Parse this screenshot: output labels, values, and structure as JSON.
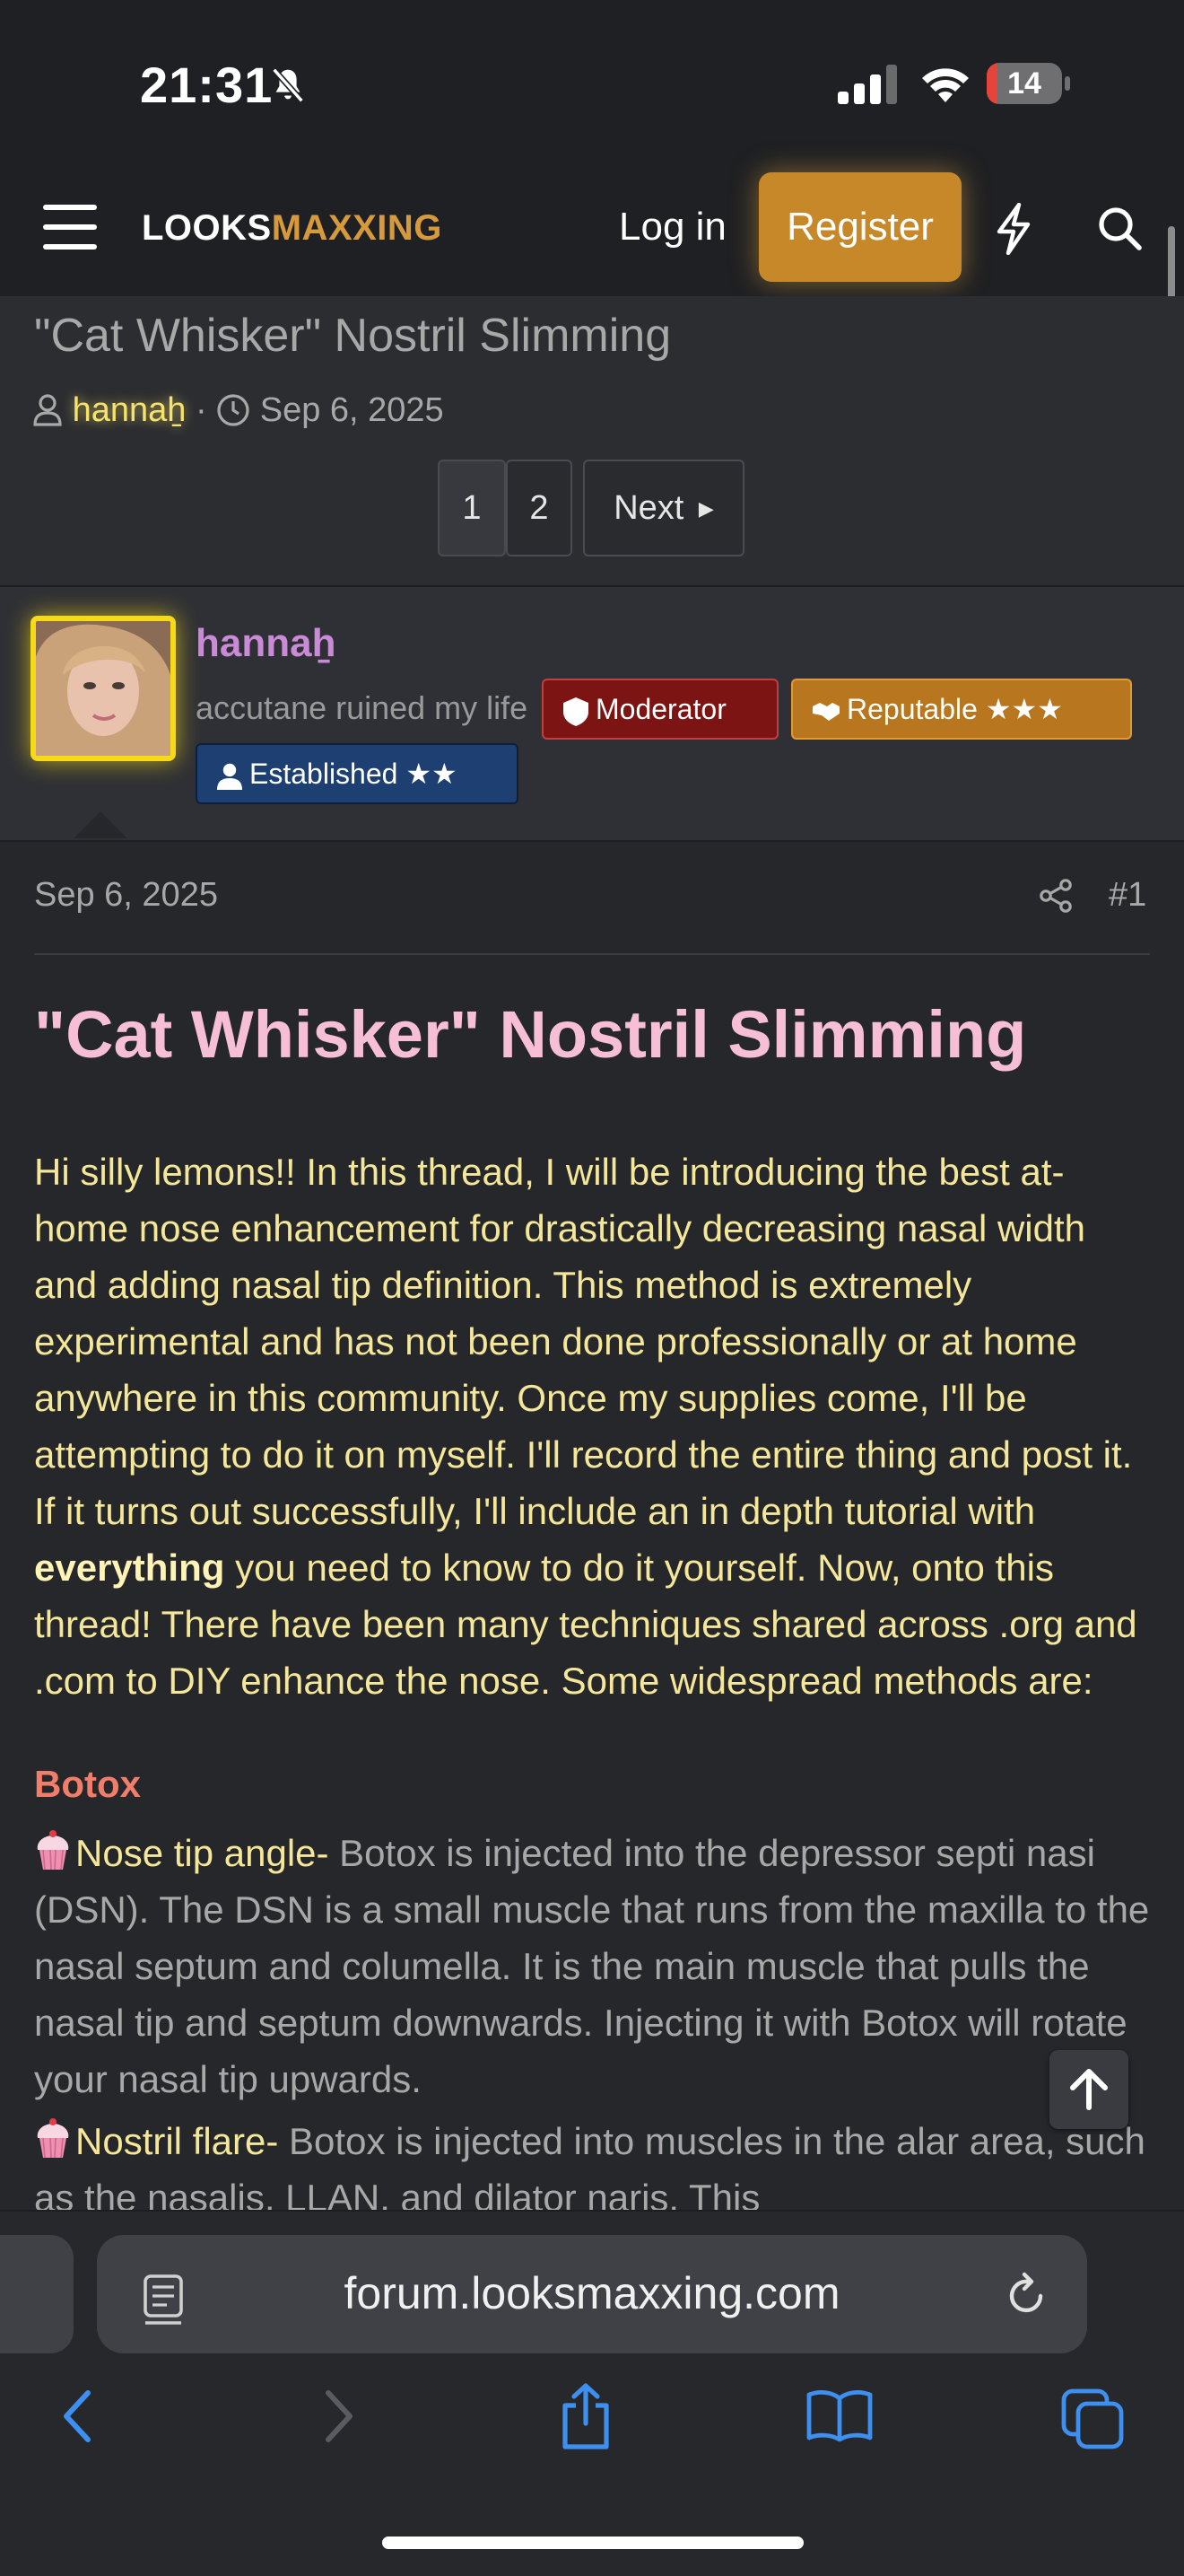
{
  "status_bar": {
    "time": "21:31",
    "battery_percent": 14
  },
  "header": {
    "logo_a": "LOOKS",
    "logo_b": "MAXXING",
    "login_label": "Log in",
    "register_label": "Register"
  },
  "thread": {
    "title": "\"Cat Whisker\" Nostril Slimming",
    "author": "hannaẖ",
    "separator": "·",
    "date": "Sep 6, 2025",
    "pages": [
      "1",
      "2"
    ],
    "current_page": "1",
    "next_label": "Next"
  },
  "user": {
    "name": "hannaẖ",
    "title": "accutane ruined my life",
    "badges": {
      "moderator": "Moderator",
      "reputable": "Reputable ★★★",
      "established": "Established ★★"
    }
  },
  "post": {
    "date": "Sep 6, 2025",
    "number": "#1",
    "title": "\"Cat Whisker\" Nostril Slimming",
    "body_1": "Hi silly lemons!! In this thread, I will be introducing the best at-home nose enhancement for drastically decreasing nasal width and adding nasal tip definition. This method is extremely experimental and has not been done professionally or at home anywhere in this community. Once my supplies come, I'll be attempting to do it on myself. I'll record the entire thing and post it. If it turns out successfully, I'll include an in depth tutorial with ",
    "body_bold": "everything",
    "body_2": " you need to know to do it yourself. Now, onto this thread! There have been many techniques shared across .org and .com to DIY enhance the nose. Some widespread methods are:",
    "section_botox": "Botox",
    "bullet_1_lead": "Nose tip angle-",
    "bullet_1_text": " Botox is injected into the depressor septi nasi (DSN). The DSN is a small muscle that runs from the maxilla to the nasal septum and columella. It is the main muscle that pulls the nasal tip and septum downwards. Injecting it with Botox will rotate your nasal tip upwards.",
    "bullet_2_lead": "Nostril flare-",
    "bullet_2_text": " Botox is injected into muscles in the alar area, such as the nasalis, LLAN, and dilator naris. This"
  },
  "browser": {
    "url": "forum.looksmaxxing.com"
  },
  "colors": {
    "accent": "#c7882a",
    "title_pink": "#f6bfd5",
    "body_yellow": "#f5e79a",
    "moderator": "#7c1414",
    "reputable": "#b8761e",
    "established": "#1d3f72"
  },
  "icons": [
    "bell-slash-icon",
    "signal-icon",
    "wifi-icon",
    "menu-icon",
    "bolt-icon",
    "search-icon",
    "user-icon",
    "clock-icon",
    "share-icon",
    "arrow-up-icon",
    "cupcake-icon",
    "reader-icon",
    "reload-icon",
    "back-icon",
    "forward-icon",
    "share-sheet-icon",
    "bookmarks-icon",
    "tabs-icon"
  ]
}
